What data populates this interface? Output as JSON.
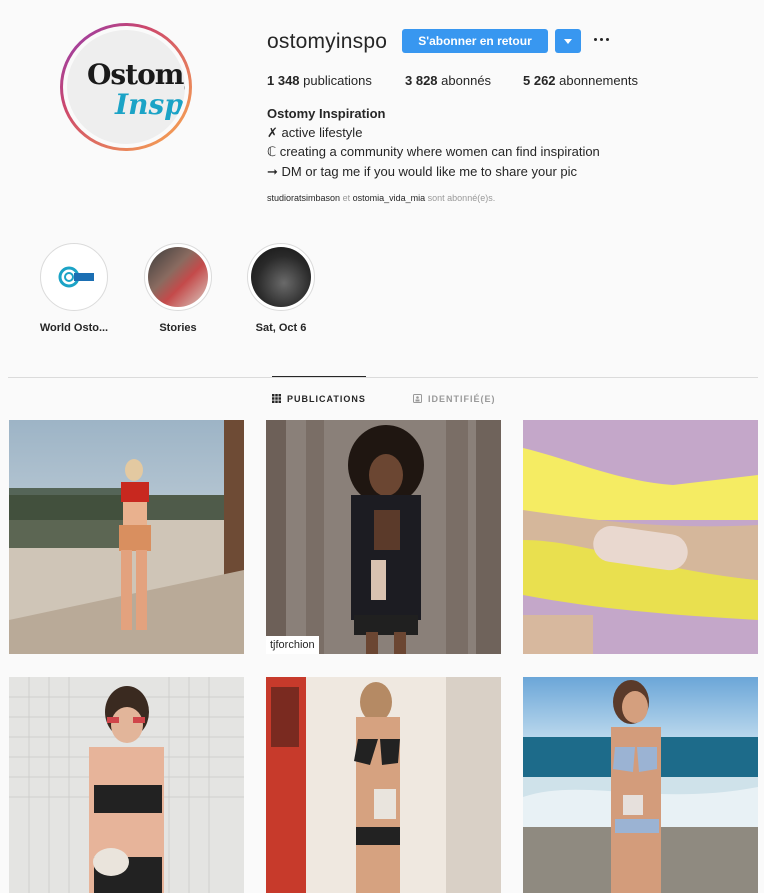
{
  "profile": {
    "username": "ostomyinspo",
    "follow_back_label": "S'abonner en retour",
    "avatar_text_1": "Ostomy",
    "avatar_text_2": "Inspo",
    "stats": {
      "posts_count": "1 348",
      "posts_label": "publications",
      "followers_count": "3 828",
      "followers_label": "abonnés",
      "following_count": "5 262",
      "following_label": "abonnements"
    },
    "bio": {
      "name": "Ostomy Inspiration",
      "lines": [
        "✗ active lifestyle",
        "ℂ creating a community where women can find inspiration",
        "➞ DM or tag me if you would like me to share your pic"
      ]
    },
    "followed_by": {
      "user1": "studioratsimbason",
      "conj": "et",
      "user2": "ostomia_vida_mia",
      "suffix": "sont abonné(e)s."
    }
  },
  "highlights": [
    {
      "label": "World Osto..."
    },
    {
      "label": "Stories"
    },
    {
      "label": "Sat, Oct 6"
    }
  ],
  "tabs": [
    {
      "label": "PUBLICATIONS",
      "active": true
    },
    {
      "label": "IDENTIFIÉ(E)",
      "active": false
    }
  ],
  "posts": [
    {
      "tag": ""
    },
    {
      "tag": "tjforchion"
    },
    {
      "tag": ""
    },
    {
      "tag": ""
    },
    {
      "tag": ""
    },
    {
      "tag": ""
    }
  ],
  "colors": {
    "accent": "#3897f0",
    "text": "#262626",
    "muted": "#999999",
    "divider": "#dbdbdb"
  },
  "icons": [
    "more-options-icon",
    "chevron-down-icon",
    "grid-icon",
    "tagged-icon"
  ]
}
